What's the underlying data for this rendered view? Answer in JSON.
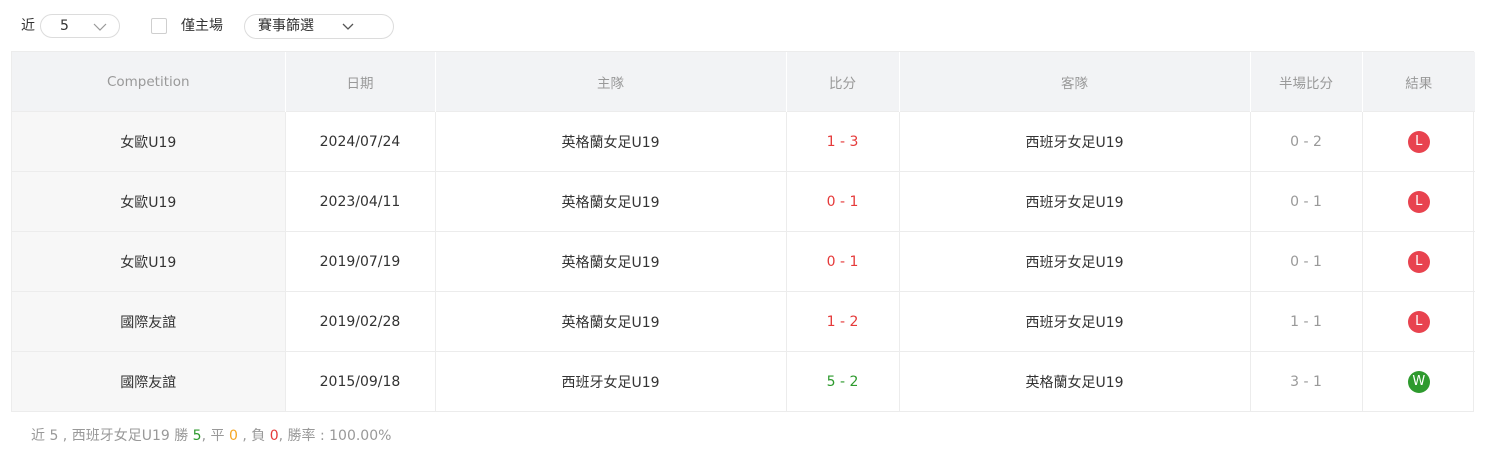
{
  "toolbar": {
    "recent_label": "近",
    "count_value": "5",
    "home_only_label": "僅主場",
    "filter_label": "賽事篩選"
  },
  "columns": [
    "Competition",
    "日期",
    "主隊",
    "比分",
    "客隊",
    "半場比分",
    "結果"
  ],
  "rows": [
    {
      "competition": "女歐U19",
      "date": "2024/07/24",
      "home": "英格蘭女足U19",
      "score": "1 - 3",
      "away": "西班牙女足U19",
      "half": "0 - 2",
      "result": "L"
    },
    {
      "competition": "女歐U19",
      "date": "2023/04/11",
      "home": "英格蘭女足U19",
      "score": "0 - 1",
      "away": "西班牙女足U19",
      "half": "0 - 1",
      "result": "L"
    },
    {
      "competition": "女歐U19",
      "date": "2019/07/19",
      "home": "英格蘭女足U19",
      "score": "0 - 1",
      "away": "西班牙女足U19",
      "half": "0 - 1",
      "result": "L"
    },
    {
      "competition": "國際友誼",
      "date": "2019/02/28",
      "home": "英格蘭女足U19",
      "score": "1 - 2",
      "away": "西班牙女足U19",
      "half": "1 - 1",
      "result": "L"
    },
    {
      "competition": "國際友誼",
      "date": "2015/09/18",
      "home": "西班牙女足U19",
      "score": "5 - 2",
      "away": "英格蘭女足U19",
      "half": "3 - 1",
      "result": "W"
    }
  ],
  "summary": {
    "prefix": "近 5 , 西班牙女足U19 勝 ",
    "wins": "5",
    "draw_text": ", 平 ",
    "draws": "0",
    "loss_text": " , 負 ",
    "losses": "0",
    "rate_text": ", 勝率 : 100.00%"
  },
  "colors": {
    "loss": "#e8434f",
    "win": "#2e9a2e",
    "draw": "#f5a623",
    "header_bg": "#f2f3f5"
  },
  "icons": {
    "dropdown": "chevron-down-icon"
  }
}
